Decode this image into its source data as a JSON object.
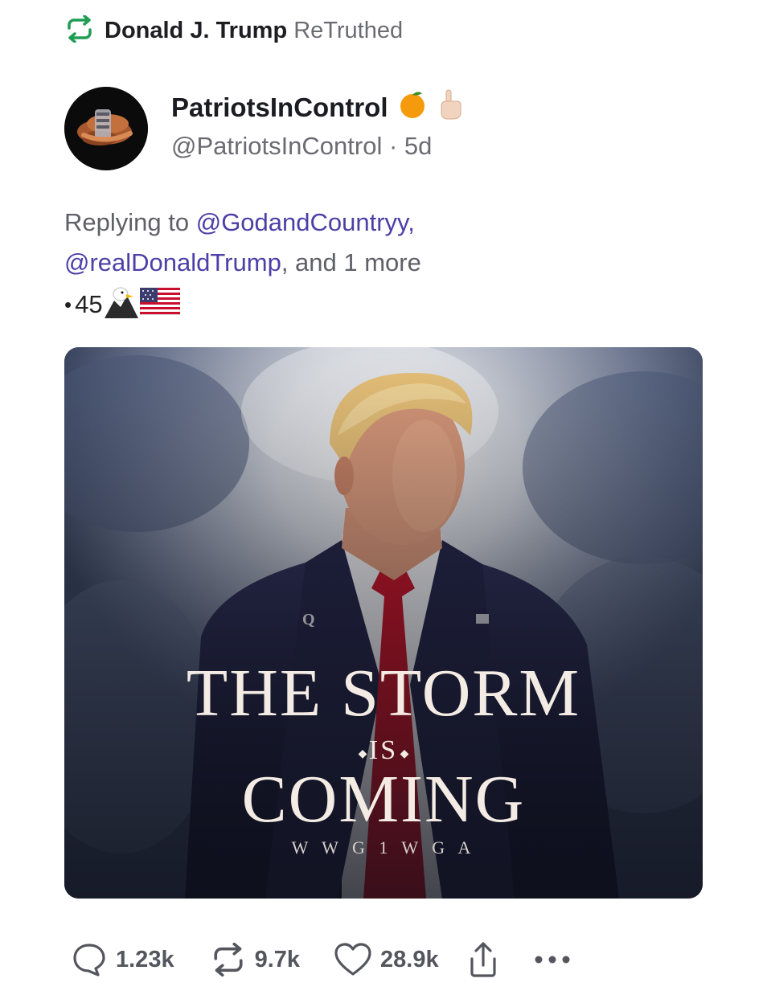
{
  "retruth": {
    "user": "Donald J. Trump",
    "verb": "ReTruthed"
  },
  "post": {
    "author_name": "PatriotsInControl",
    "author_handle": "@PatriotsInControl",
    "age": "5d",
    "reply": {
      "prefix": "Replying to",
      "mentions": [
        "@GodandCountryy,",
        "@realDonaldTrump"
      ],
      "suffix": ", and 1 more"
    },
    "flair_text": "45",
    "image": {
      "q_mark": "Q",
      "title_line1": "THE STORM",
      "title_line2": "IS",
      "title_line3": "COMING",
      "tagline": "W W G 1 W G A"
    }
  },
  "actions": {
    "replies": "1.23k",
    "retruths": "9.7k",
    "likes": "28.9k"
  },
  "colors": {
    "mention": "#4c3fa8",
    "retruth_icon": "#1f9d55",
    "tie": "#c0162b"
  },
  "icons": [
    "retruth-icon",
    "orange-circle-emoji",
    "pointing-hand-emoji",
    "eagle-emoji",
    "us-flag-emoji",
    "reply-icon",
    "share-icon",
    "more-icon",
    "heart-icon"
  ]
}
